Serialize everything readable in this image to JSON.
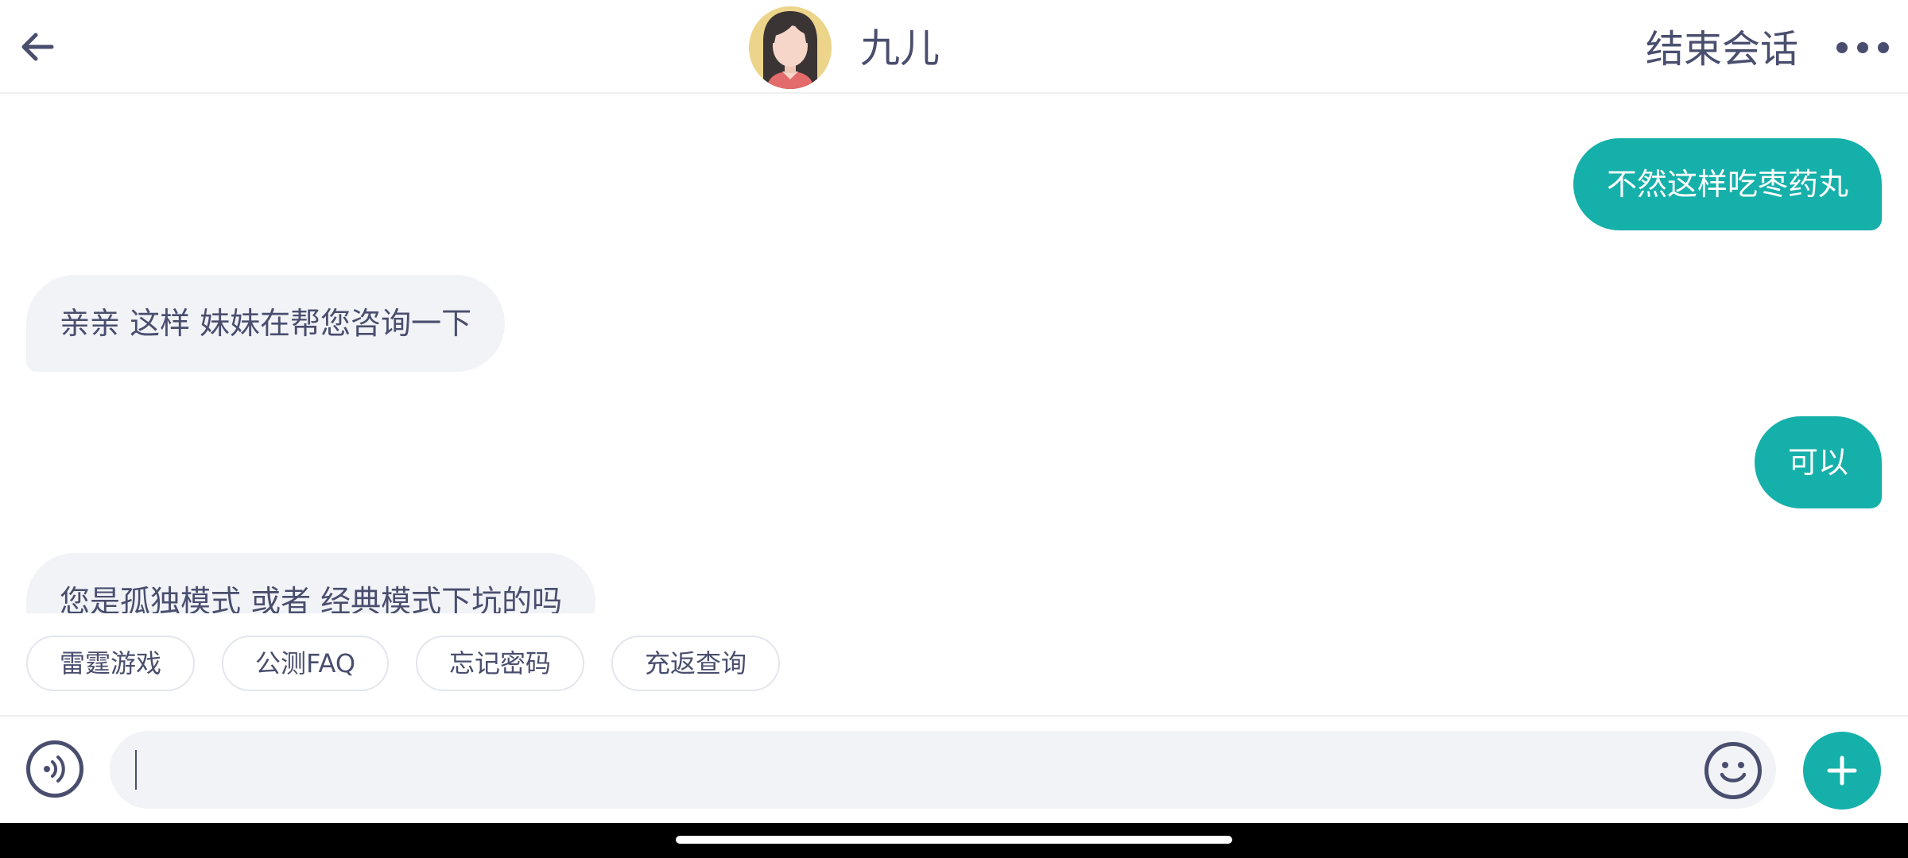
{
  "header": {
    "contact_name": "九儿",
    "end_session_label": "结束会话",
    "back_icon": "arrow-left-icon",
    "more_icon": "more-horizontal-icon"
  },
  "messages": [
    {
      "direction": "outgoing",
      "text": "不然这样吃枣药丸"
    },
    {
      "direction": "incoming",
      "text": "亲亲 这样 妹妹在帮您咨询一下"
    },
    {
      "direction": "outgoing",
      "text": "可以"
    },
    {
      "direction": "incoming",
      "text": "您是孤独模式 或者 经典模式下坑的吗"
    }
  ],
  "quick_replies": [
    "雷霆游戏",
    "公测FAQ",
    "忘记密码",
    "充返查询"
  ],
  "input": {
    "value": "",
    "voice_icon": "voice-input-icon",
    "emoji_icon": "emoji-icon",
    "plus_icon": "plus-icon"
  },
  "colors": {
    "accent": "#16b0aa",
    "text": "#4a4e6e",
    "incoming_bubble": "#f1f3f7"
  }
}
